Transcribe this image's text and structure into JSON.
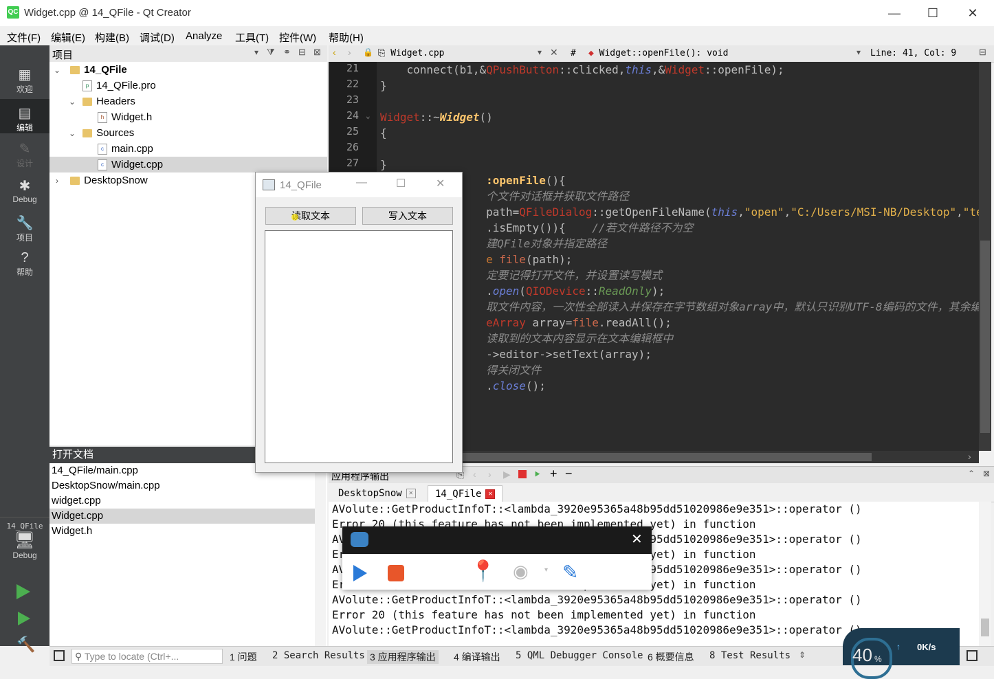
{
  "window": {
    "title": "Widget.cpp @ 14_QFile - Qt Creator"
  },
  "menu": [
    "文件(F)",
    "编辑(E)",
    "构建(B)",
    "调试(D)",
    "Analyze",
    "工具(T)",
    "控件(W)",
    "帮助(H)"
  ],
  "modes": {
    "welcome": "欢迎",
    "edit": "编辑",
    "design": "设计",
    "debug": "Debug",
    "projects": "项目",
    "help": "帮助",
    "target_project": "14_QFile",
    "target_config": "Debug"
  },
  "project_pane": {
    "title": "项目",
    "tree": {
      "root": "14_QFile",
      "pro": "14_QFile.pro",
      "headers": "Headers",
      "header_file": "Widget.h",
      "sources": "Sources",
      "main": "main.cpp",
      "widget_cpp": "Widget.cpp",
      "other_project": "DesktopSnow"
    }
  },
  "open_docs": {
    "title": "打开文档",
    "items": [
      "14_QFile/main.cpp",
      "DesktopSnow/main.cpp",
      "widget.cpp",
      "Widget.cpp",
      "Widget.h"
    ]
  },
  "editor": {
    "file_combo": "Widget.cpp",
    "symbol_combo": "Widget::openFile(): void",
    "position": "Line: 41, Col: 9",
    "hash": "#",
    "line_numbers": [
      "21",
      "22",
      "23",
      "24",
      "25",
      "26",
      "27"
    ]
  },
  "dialog": {
    "title": "14_QFile",
    "read_button": "读取文本",
    "write_button": "写入文本"
  },
  "output": {
    "header": "应用程序输出",
    "tabs": [
      "DesktopSnow",
      "14_QFile"
    ],
    "lines": [
      "AVolute::GetProductInfoT::<lambda_3920e95365a48b95dd51020986e9e351>::operator ()",
      "Error 20 (this feature has not been implemented yet) in function",
      "AVolute::GetProductInfoT::<lambda_3920e95365a48b95dd51020986e9e351>::operator ()",
      "Error 20 (this feature has not been implemented yet) in function",
      "AVolute::GetProductInfoT::<lambda_3920e95365a48b95dd51020986e9e351>::operator ()",
      "Error 20 (this feature has not been implemented yet) in function",
      "AVolute::GetProductInfoT::<lambda_3920e95365a48b95dd51020986e9e351>::operator ()",
      "Error 20 (this feature has not been implemented yet) in function",
      "AVolute::GetProductInfoT::<lambda_3920e95365a48b95dd51020986e9e351>::operator ()"
    ]
  },
  "statusbar": {
    "locator_placeholder": "Type to locate (Ctrl+...",
    "tabs": [
      "1 问题",
      "2 Search Results",
      "3 应用程序输出",
      "4 编译输出",
      "5 QML Debugger Console",
      "6 概要信息",
      "8 Test Results"
    ],
    "widget_percent": "40",
    "widget_percent_unit": "%",
    "widget_speed": "0K/s"
  },
  "colors": {
    "accent": "#41cd52",
    "mode_bar": "#404244",
    "editor_bg": "#2b2b2b",
    "record_stop": "#e8562a",
    "record_play": "#2a7ad8"
  }
}
